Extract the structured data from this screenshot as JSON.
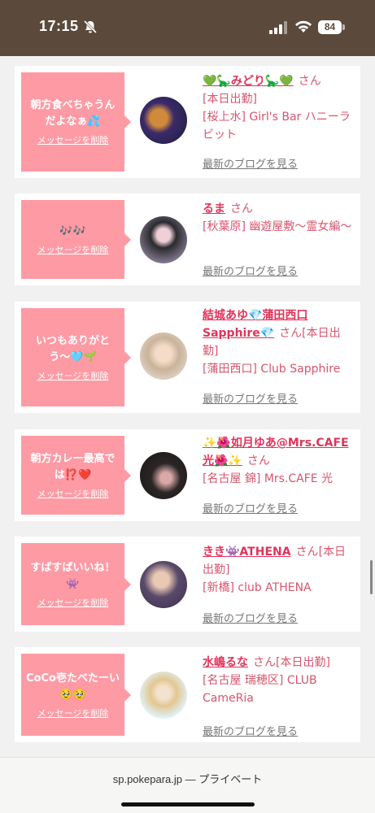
{
  "status_bar": {
    "time": "17:15",
    "battery": "84"
  },
  "delete_label": "メッセージを削除",
  "blog_label": "最新のブログを見る",
  "san": "さん",
  "cards": [
    {
      "message": "朝方食べちゃうんだよなぁ💦",
      "name": "💚🦕みどり🦕💚",
      "detail": "[本日出勤]",
      "shop": "[桜上水] Girl's Bar ハニーラビット"
    },
    {
      "message": "🎶🎶",
      "name": "るま",
      "detail": "",
      "shop": "[秋葉原] 幽遊屋敷〜霊女編〜"
    },
    {
      "message": "いつもありがとう〜🩵🌱",
      "name": "結城あゆ💎蒲田西口Sapphire💎",
      "detail": "[本日出勤]",
      "shop": "[蒲田西口] Club Sapphire"
    },
    {
      "message": "朝方カレー最高では⁉️❤️",
      "name": "✨🌺如月ゆあ@Mrs.CAFE光🌺✨",
      "detail": "",
      "shop": "[名古屋 錦] Mrs.CAFE 光"
    },
    {
      "message": "すばすばいいね！👾",
      "name": "きき👾ATHENA",
      "detail": "[本日出勤]",
      "shop": "[新橋] club ATHENA"
    },
    {
      "message": "CoCo壱たべたーい🥹🥹",
      "name": "水嶋るな",
      "detail": "[本日出勤]",
      "shop": "[名古屋 瑞穂区] CLUB CameRia"
    }
  ],
  "bottom_bar": {
    "url": "sp.pokepara.jp — プライベート"
  }
}
